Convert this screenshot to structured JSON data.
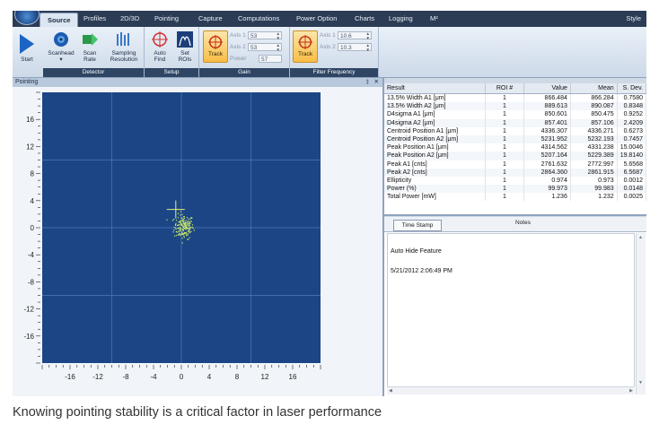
{
  "menu": {
    "tabs": [
      "Source",
      "Profiles",
      "2D/3D",
      "Pointing",
      "Capture",
      "Computations",
      "Power Option",
      "Charts",
      "Logging",
      "M²"
    ],
    "active_tab": "Source",
    "right_label": "Style"
  },
  "ribbon": {
    "start_label": "Start",
    "detector": {
      "label": "Detector",
      "scanhead": "Scanhead",
      "scan_rate": "Scan Rate",
      "sampling": "Sampling Resolution"
    },
    "setup": {
      "label": "Setup",
      "auto_find": "Auto Find",
      "set_rois": "Set ROIs"
    },
    "gain": {
      "label": "Gain",
      "track": "Track",
      "axis1_label": "Axis 1",
      "axis1_value": "53",
      "axis2_label": "Axis 2",
      "axis2_value": "53",
      "power_label": "Power",
      "power_value": "57"
    },
    "filter": {
      "label": "Filter Frequency",
      "track": "Track",
      "axis1_label": "Axis 1",
      "axis1_value": "10.6",
      "axis2_label": "Axis 2",
      "axis2_value": "10.3"
    }
  },
  "pane": {
    "title": "Pointing",
    "pin": "‡",
    "close": "✕"
  },
  "chart_data": {
    "type": "scatter",
    "xlim": [
      -20,
      20
    ],
    "ylim": [
      -20,
      20
    ],
    "x_ticks": [
      -16,
      -12,
      -8,
      -4,
      0,
      4,
      8,
      12,
      16
    ],
    "y_ticks": [
      16,
      12,
      8,
      4,
      0,
      -4,
      -8,
      -12,
      -16
    ],
    "grid_x": [
      -10,
      0,
      10
    ],
    "grid_y": [
      -10,
      0,
      10
    ],
    "background": "#1b4585",
    "point_color": "#c8e86a",
    "crosshair": {
      "x": -0.8,
      "y": 2.7,
      "color": "#e8f07a"
    },
    "cluster": {
      "center_x": 0.3,
      "center_y": 0.2,
      "spread_x": 0.7,
      "spread_y": 0.9,
      "count": 180
    }
  },
  "results": {
    "headers": [
      "Result",
      "ROI #",
      "Value",
      "Mean",
      "S. Dev."
    ],
    "rows": [
      [
        "13.5% Width A1 [μm]",
        "1",
        "866.484",
        "866.284",
        "0.7580"
      ],
      [
        "13.5% Width A2 [μm]",
        "1",
        "889.613",
        "890.087",
        "0.8348"
      ],
      [
        "D4sigma A1 [μm]",
        "1",
        "850.601",
        "850.475",
        "0.9252"
      ],
      [
        "D4sigma A2 [μm]",
        "1",
        "857.401",
        "857.106",
        "2.4209"
      ],
      [
        "Centroid Position A1 [μm]",
        "1",
        "4336.307",
        "4336.271",
        "0.6273"
      ],
      [
        "Centroid Position A2 [μm]",
        "1",
        "5231.952",
        "5232.193",
        "0.7457"
      ],
      [
        "Peak Position A1 [μm]",
        "1",
        "4314.562",
        "4331.238",
        "15.0046"
      ],
      [
        "Peak Position A2 [μm]",
        "1",
        "5207.164",
        "5229.389",
        "19.8140"
      ],
      [
        "Peak A1 [cnts]",
        "1",
        "2761.632",
        "2772.997",
        "5.6568"
      ],
      [
        "Peak A2 [cnts]",
        "1",
        "2864.360",
        "2861.915",
        "6.5687"
      ],
      [
        "Ellipticity",
        "1",
        "0.974",
        "0.973",
        "0.0012"
      ],
      [
        "Power (%)",
        "1",
        "99.973",
        "99.983",
        "0.0148"
      ],
      [
        "Total Power [mW]",
        "1",
        "1.236",
        "1.232",
        "0.0025"
      ]
    ]
  },
  "notes": {
    "timestamp_button": "Time Stamp",
    "notes_label": "Notes",
    "line1": "Auto Hide Feature",
    "line2": "5/21/2012 2:06:49 PM"
  },
  "caption": "Knowing pointing stability is a critical factor in laser performance"
}
